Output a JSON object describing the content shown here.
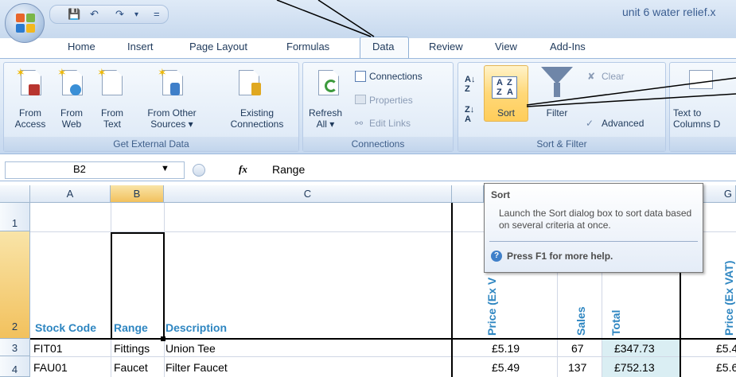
{
  "window": {
    "title": "unit 6 water relief.x"
  },
  "quick_access": {
    "save_icon": "save-icon",
    "undo_icon": "undo-icon",
    "redo_icon": "redo-icon",
    "customize": "▾",
    "sep": "="
  },
  "tabs": [
    {
      "label": "Home"
    },
    {
      "label": "Insert"
    },
    {
      "label": "Page Layout"
    },
    {
      "label": "Formulas"
    },
    {
      "label": "Data"
    },
    {
      "label": "Review"
    },
    {
      "label": "View"
    },
    {
      "label": "Add-Ins"
    }
  ],
  "ribbon": {
    "get_external": {
      "label": "Get External Data",
      "from_access": [
        "From",
        "Access"
      ],
      "from_web": [
        "From",
        "Web"
      ],
      "from_text": [
        "From",
        "Text"
      ],
      "from_other": [
        "From Other",
        "Sources ▾"
      ],
      "existing": [
        "Existing",
        "Connections"
      ]
    },
    "connections": {
      "label": "Connections",
      "refresh": [
        "Refresh",
        "All ▾"
      ],
      "connections": "Connections",
      "properties": "Properties",
      "edit_links": "Edit Links"
    },
    "sort_filter": {
      "label": "Sort & Filter",
      "sort_az": "A↓Z",
      "sort": "Sort",
      "filter": "Filter",
      "clear": "Clear",
      "advanced": "Advanced"
    },
    "data_tools": {
      "text_to_columns": [
        "Text to",
        "Columns D"
      ]
    }
  },
  "formula_bar": {
    "name_box": "B2",
    "fx": "fx",
    "value": "Range"
  },
  "columns": [
    "A",
    "B",
    "C",
    "G"
  ],
  "rows": [
    "1",
    "2",
    "3",
    "4"
  ],
  "sheet": {
    "headers": {
      "stock_code": "Stock Code",
      "range": "Range",
      "description": "Description",
      "price": "Price (Ex V",
      "sales": "Sales",
      "total": "Total",
      "price_g": "Price (Ex VAT)"
    },
    "data": [
      {
        "code": "FIT01",
        "range": "Fittings",
        "desc": "Union Tee",
        "price": "£5.19",
        "sales": "67",
        "total": "£347.73",
        "g": "£5.4"
      },
      {
        "code": "FAU01",
        "range": "Faucet",
        "desc": "Filter Faucet",
        "price": "£5.49",
        "sales": "137",
        "total": "£752.13",
        "g": "£5.6"
      }
    ]
  },
  "tooltip": {
    "title": "Sort",
    "body": "Launch the Sort dialog box to sort data based on several criteria at once.",
    "help": "Press F1 for more help."
  }
}
